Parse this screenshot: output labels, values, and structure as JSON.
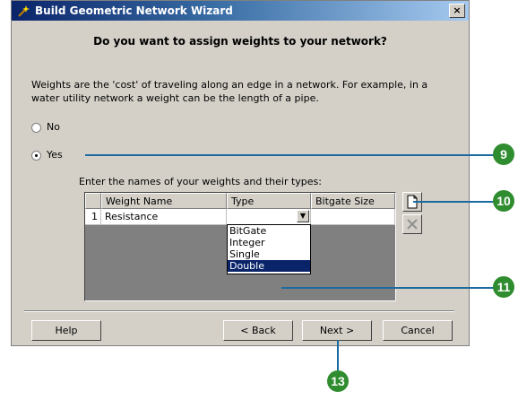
{
  "window": {
    "title": "Build Geometric Network Wizard",
    "close_glyph": "×"
  },
  "question": "Do you want to assign weights to your network?",
  "description": "Weights are the 'cost' of traveling along an edge in a network. For example, in a water utility network a weight can be the length of a pipe.",
  "options": {
    "no_label": "No",
    "yes_label": "Yes",
    "selected": "Yes"
  },
  "weights_label": "Enter the names of your weights and their types:",
  "table": {
    "headers": [
      "Weight Name",
      "Type",
      "Bitgate Size"
    ],
    "rows": [
      {
        "index": "1",
        "name": "Resistance",
        "type": "",
        "bitgate": ""
      }
    ]
  },
  "type_dropdown": {
    "items": [
      "BitGate",
      "Integer",
      "Single",
      "Double"
    ],
    "selected": "Double",
    "arrow": "▼"
  },
  "buttons": {
    "help": "Help",
    "back": "< Back",
    "next": "Next >",
    "cancel": "Cancel"
  },
  "callouts": [
    "9",
    "10",
    "11",
    "13"
  ],
  "colors": {
    "callout_green": "#2f8c2f",
    "callout_line": "#1b6aa0",
    "selection": "#0a246a"
  }
}
